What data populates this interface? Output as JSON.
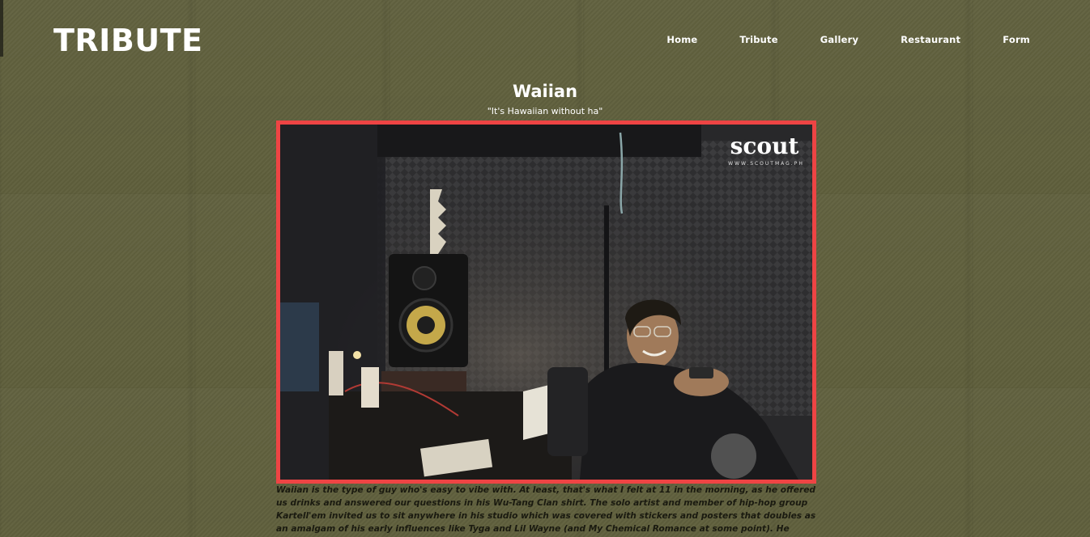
{
  "header": {
    "logo": "TRIBUTE",
    "nav": [
      "Home",
      "Tribute",
      "Gallery",
      "Restaurant",
      "Form"
    ]
  },
  "main": {
    "title": "Waiian",
    "subtitle": "\"It's Hawaiian without ha\"",
    "photo": {
      "watermark": "scout",
      "watermark_url": "WWW.SCOUTMAG.PH",
      "frame_color": "#ee4444"
    },
    "article": "Waiian is the type of guy who's easy to vibe with. At least, that's what I felt at 11 in the morning, as he offered us drinks and answered our questions in his Wu-Tang Clan shirt. The solo artist and member of hip-hop group Kartell'em invited us to sit anywhere in his studio which was covered with stickers and posters that doubles as an amalgam of his early influences like Tyga and Lil Wayne (and My Chemical Romance at some point). He suddenly apologized for the lack of"
  }
}
